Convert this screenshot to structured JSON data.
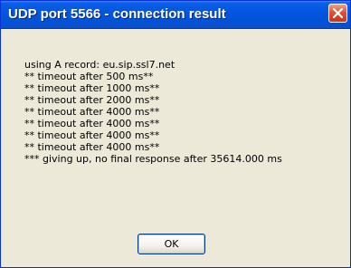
{
  "dialog": {
    "title": "UDP port 5566 - connection result",
    "close_icon": "close-icon",
    "message_lines": [
      "using A record: eu.sip.ssl7.net",
      "** timeout after 500 ms**",
      "** timeout after 1000 ms**",
      "** timeout after 2000 ms**",
      "** timeout after 4000 ms**",
      "** timeout after 4000 ms**",
      "** timeout after 4000 ms**",
      "** timeout after 4000 ms**",
      "*** giving up, no final response after 35614.000 ms"
    ],
    "ok_label": "OK"
  },
  "colors": {
    "titlebar": "#0255dd",
    "close_button": "#e4512f",
    "dialog_face": "#ece9d8"
  }
}
